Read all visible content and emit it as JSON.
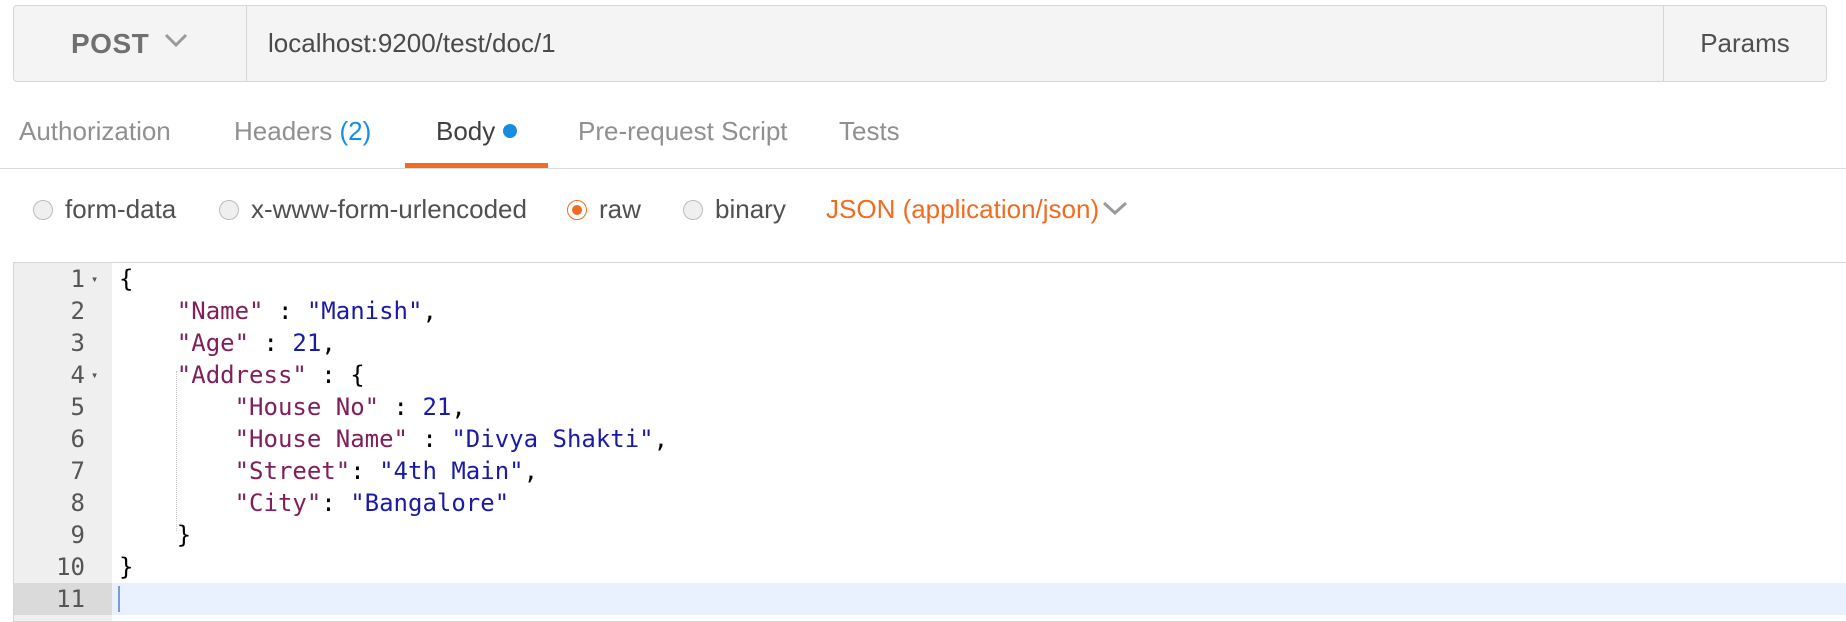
{
  "request": {
    "method": "POST",
    "url": "localhost:9200/test/doc/1",
    "params_label": "Params"
  },
  "tabs": [
    {
      "label": "Authorization"
    },
    {
      "label": "Headers",
      "count": "(2)"
    },
    {
      "label": "Body",
      "active": true
    },
    {
      "label": "Pre-request Script"
    },
    {
      "label": "Tests"
    }
  ],
  "body_types": [
    {
      "label": "form-data",
      "checked": false
    },
    {
      "label": "x-www-form-urlencoded",
      "checked": false
    },
    {
      "label": "raw",
      "checked": true
    },
    {
      "label": "binary",
      "checked": false
    }
  ],
  "content_type": "JSON (application/json)",
  "editor": {
    "lines": [
      {
        "n": "1",
        "fold": true,
        "tokens": [
          [
            "p",
            "{"
          ]
        ]
      },
      {
        "n": "2",
        "tokens": [
          [
            "p",
            "    "
          ],
          [
            "k",
            "\"Name\""
          ],
          [
            "p",
            " : "
          ],
          [
            "s",
            "\"Manish\""
          ],
          [
            "p",
            ","
          ]
        ]
      },
      {
        "n": "3",
        "tokens": [
          [
            "p",
            "    "
          ],
          [
            "k",
            "\"Age\""
          ],
          [
            "p",
            " : "
          ],
          [
            "n",
            "21"
          ],
          [
            "p",
            ","
          ]
        ]
      },
      {
        "n": "4",
        "fold": true,
        "tokens": [
          [
            "p",
            "    "
          ],
          [
            "k",
            "\"Address\""
          ],
          [
            "p",
            " : {"
          ]
        ]
      },
      {
        "n": "5",
        "tokens": [
          [
            "p",
            "        "
          ],
          [
            "k",
            "\"House No\""
          ],
          [
            "p",
            " : "
          ],
          [
            "n",
            "21"
          ],
          [
            "p",
            ","
          ]
        ]
      },
      {
        "n": "6",
        "tokens": [
          [
            "p",
            "        "
          ],
          [
            "k",
            "\"House Name\""
          ],
          [
            "p",
            " : "
          ],
          [
            "s",
            "\"Divya Shakti\""
          ],
          [
            "p",
            ","
          ]
        ]
      },
      {
        "n": "7",
        "tokens": [
          [
            "p",
            "        "
          ],
          [
            "k",
            "\"Street\""
          ],
          [
            "p",
            ": "
          ],
          [
            "s",
            "\"4th Main\""
          ],
          [
            "p",
            ","
          ]
        ]
      },
      {
        "n": "8",
        "tokens": [
          [
            "p",
            "        "
          ],
          [
            "k",
            "\"City\""
          ],
          [
            "p",
            ": "
          ],
          [
            "s",
            "\"Bangalore\""
          ]
        ]
      },
      {
        "n": "9",
        "tokens": [
          [
            "p",
            "    }"
          ]
        ]
      },
      {
        "n": "10",
        "tokens": [
          [
            "p",
            "}"
          ]
        ]
      },
      {
        "n": "11",
        "current": true,
        "tokens": []
      }
    ]
  },
  "colors": {
    "accent": "#f26b21",
    "count_blue": "#1a8ce0",
    "json_key": "#801f5a",
    "json_value": "#1a1aa6"
  }
}
